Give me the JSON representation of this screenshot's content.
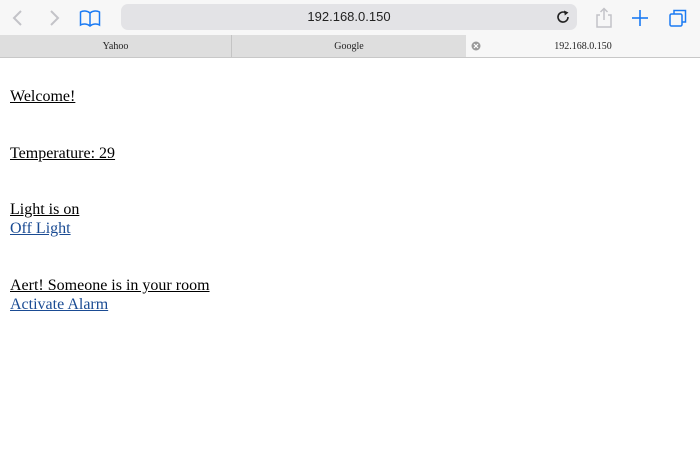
{
  "browser": {
    "url": "192.168.0.150",
    "tabs": [
      {
        "label": "Yahoo"
      },
      {
        "label": "Google"
      },
      {
        "label": "192.168.0.150"
      }
    ]
  },
  "page": {
    "welcome": "Welcome!",
    "temperature": "Temperature: 29",
    "light_status": "Light is on",
    "light_link": "Off Light",
    "alert_text": "Aert! Someone is in your room",
    "alarm_link": "Activate Alarm"
  },
  "colors": {
    "link": "#1a4b93",
    "accent": "#1a7af3"
  }
}
